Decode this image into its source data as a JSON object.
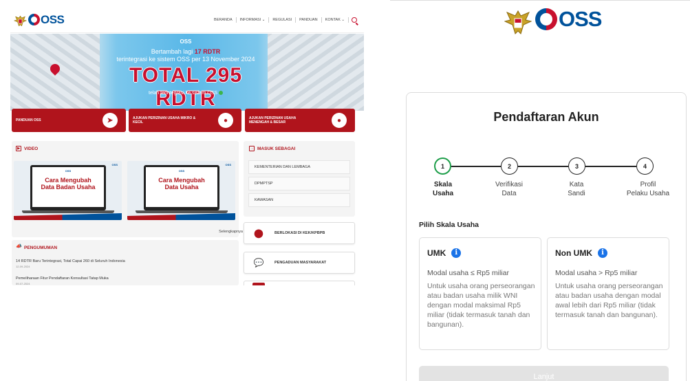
{
  "left_site": {
    "logo_text": "OSS",
    "nav": [
      "BERANDA",
      "INFORMASI ⌄",
      "REGULASI",
      "PANDUAN",
      "KONTAK ⌄"
    ],
    "banner": {
      "logos_text": "OSS",
      "line1_prefix": "Bertambah lagi",
      "line1_highlight": "17 RDTR",
      "line2": "terintegrasi ke sistem OSS per 13 November 2024",
      "total": "TOTAL 295 RDTR",
      "line3": "telah terintegrasi ke sistem OSS"
    },
    "quick_buttons": [
      "PANDUAN OSS",
      "AJUKAN PERIZINAN USAHA MIKRO & KECIL",
      "AJUKAN PERIZINAN USAHA MENENGAH & BESAR"
    ],
    "video": {
      "heading": "VIDEO",
      "items": [
        {
          "line1": "Cara Mengubah",
          "line2": "Data Badan Usaha"
        },
        {
          "line1": "Cara Mengubah",
          "line2": "Data Usaha"
        }
      ],
      "more": "Selengkapnya"
    },
    "pengumuman": {
      "heading": "PENGUMUMAN",
      "items": [
        {
          "title": "14 RDTR Baru Terintegrasi, Total Capai 260 di Seluruh Indonesia",
          "date": "12-09-2024"
        },
        {
          "title": "Pemeliharaan Fitur Pendaftaran Konsultasi Tatap Muka",
          "date": "09-07-2024"
        }
      ]
    },
    "masuk": {
      "heading": "MASUK SEBAGAI",
      "items": [
        "KEMENTERIAN DAN LEMBAGA",
        "DPMPTSP",
        "KAWASAN"
      ]
    },
    "side_links": [
      "BERLOKASI DI KEK/KPBPB",
      "PENGADUAN MASYARAKAT"
    ]
  },
  "registration": {
    "logo_text": "OSS",
    "title": "Pendaftaran Akun",
    "steps": [
      {
        "num": "1",
        "line1": "Skala",
        "line2": "Usaha"
      },
      {
        "num": "2",
        "line1": "Verifikasi",
        "line2": "Data"
      },
      {
        "num": "3",
        "line1": "Kata",
        "line2": "Sandi"
      },
      {
        "num": "4",
        "line1": "Profil",
        "line2": "Pelaku Usaha"
      }
    ],
    "active_step": 1,
    "choose_label": "Pilih Skala Usaha",
    "options": [
      {
        "title": "UMK",
        "subtitle": "Modal usaha ≤ Rp5 miliar",
        "description": "Untuk usaha orang perseorangan atau badan usaha milik WNI dengan modal maksimal Rp5 miliar (tidak termasuk tanah dan bangunan)."
      },
      {
        "title": "Non UMK",
        "subtitle": "Modal usaha > Rp5 miliar",
        "description": "Untuk usaha orang perseorangan atau badan usaha dengan modal awal lebih dari Rp5 miliar (tidak termasuk tanah dan bangunan)."
      }
    ],
    "submit_label": "Lanjut"
  },
  "colors": {
    "brand_red": "#b0141c",
    "brand_blue": "#00529b",
    "active_step": "#1e9e4a",
    "info_icon": "#1a73e8",
    "disabled_button": "#e3e3e3"
  }
}
